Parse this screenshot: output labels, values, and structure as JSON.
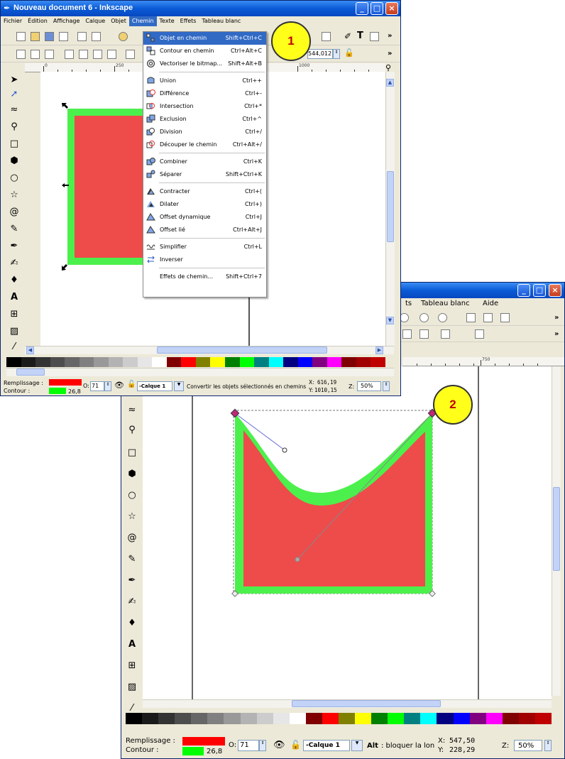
{
  "win1": {
    "title": "Nouveau document 6 - Inkscape",
    "menus": [
      "Fichier",
      "Édition",
      "Affichage",
      "Calque",
      "Objet",
      "Chemin",
      "Texte",
      "Effets",
      "Tableau blanc"
    ],
    "active_menu": "Chemin",
    "toolbar_value": "544,012",
    "chevron": "»",
    "ruler_labels": [
      "0",
      "250",
      "1000"
    ],
    "status": {
      "fill_label": "Remplissage :",
      "stroke_label": "Contour :",
      "stroke_width": "26,8",
      "opacity_label": "O:",
      "opacity": "71",
      "layer": "-Calque 1",
      "message": "Convertir les objets sélectionnés en chemins",
      "x_label": "X:",
      "x": "616,19",
      "y_label": "Y:",
      "y": "1010,15",
      "zoom_label": "Z:",
      "zoom": "50%"
    }
  },
  "menu_items": [
    {
      "label": "Objet en chemin",
      "shortcut": "Shift+Ctrl+C",
      "highlight": true
    },
    {
      "label": "Contour en chemin",
      "shortcut": "Ctrl+Alt+C"
    },
    {
      "label": "Vectoriser le bitmap...",
      "shortcut": "Shift+Alt+B"
    },
    {
      "label": "Union",
      "shortcut": "Ctrl++"
    },
    {
      "label": "Différence",
      "shortcut": "Ctrl+-"
    },
    {
      "label": "Intersection",
      "shortcut": "Ctrl+*"
    },
    {
      "label": "Exclusion",
      "shortcut": "Ctrl+^"
    },
    {
      "label": "Division",
      "shortcut": "Ctrl+/"
    },
    {
      "label": "Découper le chemin",
      "shortcut": "Ctrl+Alt+/"
    },
    {
      "label": "Combiner",
      "shortcut": "Ctrl+K"
    },
    {
      "label": "Séparer",
      "shortcut": "Shift+Ctrl+K"
    },
    {
      "label": "Contracter",
      "shortcut": "Ctrl+("
    },
    {
      "label": "Dilater",
      "shortcut": "Ctrl+)"
    },
    {
      "label": "Offset dynamique",
      "shortcut": "Ctrl+J"
    },
    {
      "label": "Offset lié",
      "shortcut": "Ctrl+Alt+J"
    },
    {
      "label": "Simplifier",
      "shortcut": "Ctrl+L"
    },
    {
      "label": "Inverser",
      "shortcut": ""
    },
    {
      "label": "Effets de chemin...",
      "shortcut": "Shift+Ctrl+7"
    }
  ],
  "win2": {
    "menus_partial": [
      "ts",
      "Tableau blanc",
      "Aide"
    ],
    "chevron": "»",
    "ruler_label": "750",
    "status": {
      "fill_label": "Remplissage :",
      "stroke_label": "Contour :",
      "stroke_width": "26,8",
      "opacity_label": "O:",
      "opacity": "71",
      "layer": "-Calque 1",
      "message_bold": "Alt",
      "message": ": bloquer la lon",
      "x_label": "X:",
      "x": "547,50",
      "y_label": "Y:",
      "y": "228,29",
      "zoom_label": "Z:",
      "zoom": "50%"
    }
  },
  "callouts": {
    "one": "1",
    "two": "2"
  },
  "colors": {
    "shape_fill": "#ee4b4b",
    "shape_stroke": "#4cf04c",
    "menu_highlight": "#316ac5",
    "callout_bg": "#ffff1a",
    "callout_text": "#c00000",
    "title_blue": "#0a5bd6"
  },
  "palette": [
    "#000000",
    "#1a1a1a",
    "#333333",
    "#4d4d4d",
    "#666666",
    "#808080",
    "#999999",
    "#b3b3b3",
    "#cccccc",
    "#e6e6e6",
    "#ffffff",
    "#800000",
    "#ff0000",
    "#808000",
    "#ffff00",
    "#008000",
    "#00ff00",
    "#008080",
    "#00ffff",
    "#000080",
    "#0000ff",
    "#800080",
    "#ff00ff",
    "#800000",
    "#a00000",
    "#c00000"
  ]
}
